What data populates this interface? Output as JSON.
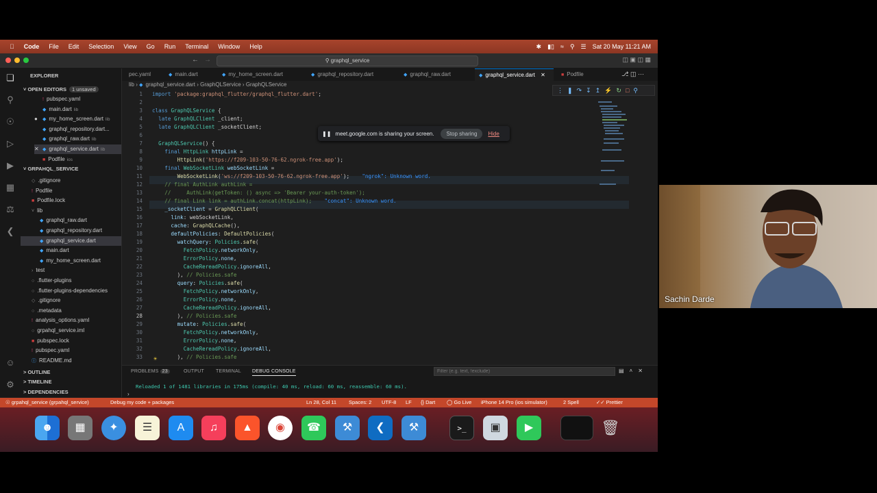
{
  "menubar": {
    "apple_icon": "apple-icon",
    "items": [
      "Code",
      "File",
      "Edit",
      "Selection",
      "View",
      "Go",
      "Run",
      "Terminal",
      "Window",
      "Help"
    ],
    "datetime": "Sat 20 May  11:21 AM"
  },
  "titlebar": {
    "command_center": "graphql_service"
  },
  "sidebar": {
    "title": "EXPLORER",
    "open_editors_label": "OPEN EDITORS",
    "unsaved_badge": "1 unsaved",
    "open_editors": [
      {
        "name": "pubspec.yaml",
        "suffix": ""
      },
      {
        "name": "main.dart",
        "suffix": "lib"
      },
      {
        "name": "my_home_screen.dart",
        "suffix": "lib"
      },
      {
        "name": "graphql_repository.dart...",
        "suffix": ""
      },
      {
        "name": "graphql_raw.dart",
        "suffix": "lib"
      },
      {
        "name": "graphql_service.dart",
        "suffix": "lib"
      },
      {
        "name": "Podfile",
        "suffix": "ios"
      }
    ],
    "project_label": "GRPAHQL_SERVICE",
    "tree": [
      {
        "name": ".gitignore",
        "type": "git"
      },
      {
        "name": "Podfile",
        "type": "yl"
      },
      {
        "name": "Podfile.lock",
        "type": "lk"
      },
      {
        "name": "lib",
        "type": "folder"
      },
      {
        "name": "graphql_raw.dart",
        "type": "dt"
      },
      {
        "name": "graphql_repository.dart",
        "type": "dt"
      },
      {
        "name": "graphql_service.dart",
        "type": "dt"
      },
      {
        "name": "main.dart",
        "type": "dt"
      },
      {
        "name": "my_home_screen.dart",
        "type": "dt"
      },
      {
        "name": "test",
        "type": "folder"
      },
      {
        "name": ".flutter-plugins",
        "type": "gt"
      },
      {
        "name": ".flutter-plugins-dependencies",
        "type": "gt"
      },
      {
        "name": ".gitignore",
        "type": "git"
      },
      {
        "name": ".metadata",
        "type": "gt"
      },
      {
        "name": "analysis_options.yaml",
        "type": "yl"
      },
      {
        "name": "grpahql_service.iml",
        "type": "gt"
      },
      {
        "name": "pubspec.lock",
        "type": "lk"
      },
      {
        "name": "pubspec.yaml",
        "type": "yl"
      },
      {
        "name": "README.md",
        "type": "dt"
      }
    ],
    "outline_label": "OUTLINE",
    "timeline_label": "TIMELINE",
    "dependencies_label": "DEPENDENCIES"
  },
  "tabs": [
    "pec.yaml",
    "main.dart",
    "my_home_screen.dart",
    "graphql_repository.dart",
    "graphql_raw.dart",
    "graphql_service.dart",
    "Podfile"
  ],
  "breadcrumbs": [
    "lib",
    "graphql_service.dart",
    "GraphQLService",
    "GraphQLService"
  ],
  "share_banner": {
    "message": "meet.google.com is sharing your screen.",
    "stop": "Stop sharing",
    "hide": "Hide"
  },
  "panel": {
    "tabs": [
      "PROBLEMS",
      "OUTPUT",
      "TERMINAL",
      "DEBUG CONSOLE"
    ],
    "problems_count": "23",
    "filter_placeholder": "Filter (e.g. text, !exclude)",
    "log_line": "Reloaded 1 of 1481 libraries in 175ms (compile: 40 ms, reload: 60 ms, reassemble: 60 ms)."
  },
  "statusbar": {
    "branch": "grpahql_service (grpahql_service)",
    "debug": "Debug my code + packages",
    "position": "Ln 28, Col 11",
    "spaces": "Spaces: 2",
    "encoding": "UTF-8",
    "eol": "LF",
    "lang": "Dart",
    "golive": "Go Live",
    "device": "iPhone 14 Pro (ios simulator)",
    "spell": "2 Spell",
    "prettier": "Prettier"
  },
  "video": {
    "participant": "Sachin Darde"
  }
}
